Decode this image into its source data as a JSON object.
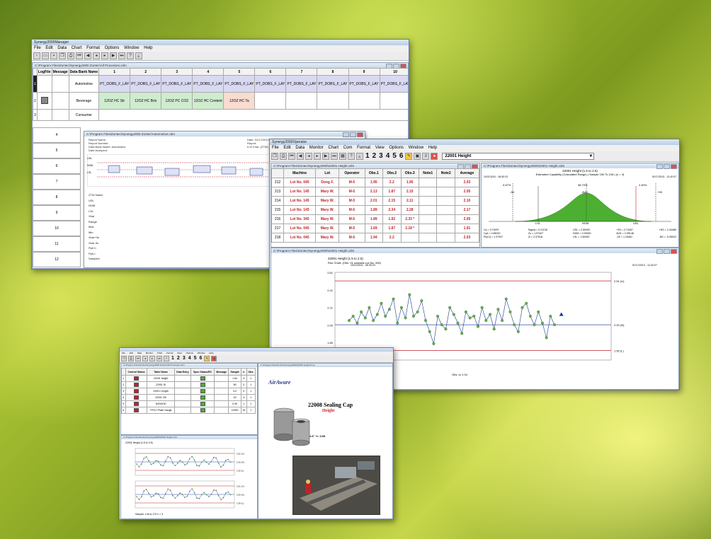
{
  "manager": {
    "title": "Synergy2000Manager",
    "menu": [
      "File",
      "Edit",
      "Data",
      "Chart",
      "Format",
      "Options",
      "Window",
      "Help"
    ],
    "doc_title": "C:\\Program Files\\Zontec\\Synergy2000 Zontec\\All Processes.cdm",
    "col_headers": [
      "LogFile",
      "Message",
      "Data Bank Name",
      "1",
      "2",
      "3",
      "4",
      "5",
      "6",
      "7",
      "8",
      "9",
      "10"
    ],
    "row_numbers": [
      "1",
      "2",
      "3",
      "4",
      "5",
      "6",
      "7",
      "8",
      "9",
      "10",
      "11",
      "12"
    ],
    "row1_name": "Automotive",
    "row2_name": "Beverage",
    "row3_name": "Consumer",
    "row1_cells": [
      "PT_DOBS_F_LAY",
      "PT_DOBS_F_LAY",
      "PT_DOBS_F_LAY",
      "PT_DOBS_F_LAY",
      "PT_DOBS_F_LAY",
      "PT_DOBS_F_LAY",
      "PT_DOBS_F_LAY",
      "PT_DOBS_F_LAY",
      "PT_DOBS_F_LAY",
      "PT_DOBS_F_LAY"
    ],
    "row2_cells": [
      "12OZ HC Str",
      "12OZ HC Brix",
      "12OZ PC CO2",
      "12OZ HC Content",
      "12OZ HC Ta"
    ],
    "inner_title": "C:\\Program Files\\Zontec\\Synergy2000 Zontec\\Automotive.cdm",
    "inner_info": [
      "Report Name:",
      "Report Number:",
      "Data Bank Name: Automotive",
      "Date Analyzed:"
    ],
    "inner_info_right": [
      "Date: 01/17/2013",
      "Report:",
      "# of Char. (ZTW) Rows: 10"
    ],
    "chart_labels": [
      "USL",
      "NOM",
      "LSL"
    ],
    "stat_rows": [
      "ZTW Name",
      "USL",
      "NOM",
      "LSL",
      "Xbar",
      "Range",
      "Max",
      "Min",
      "Xbar+3s",
      "Xbar-3s",
      "Ppk+/-",
      "Ppk-/-",
      "Samples"
    ]
  },
  "operator": {
    "title": "Synergy2000Operator",
    "menu": [
      "File",
      "Edit",
      "Data",
      "Monitor",
      "Chart",
      "Com",
      "Format",
      "View",
      "Options",
      "Window",
      "Help"
    ],
    "toolbar_numbers": [
      "1",
      "2",
      "3",
      "4",
      "5",
      "6"
    ],
    "combo_value": "22001 Height",
    "table_title": "C:\\Program Files\\Zontec\\Synergy2000\\22001 Height.cdm",
    "table_headers": [
      "",
      "Machine",
      "Lot",
      "Operator",
      "Obs.1",
      "Obs.2",
      "Obs.3",
      "Note1",
      "Note2",
      "Average"
    ],
    "rows": [
      {
        "n": "212",
        "machine": "Lot No. 045",
        "lot": "Dong F.",
        "op": "M-5",
        "o1": "1.95",
        "o2": "2.2",
        "o3": "1.95",
        "avg": "2.03"
      },
      {
        "n": "213",
        "machine": "Lot No. 145",
        "lot": "Mary W.",
        "op": "M-5",
        "o1": "2.13",
        "o2": "1.87",
        "o3": "2.15",
        "avg": "2.05"
      },
      {
        "n": "214",
        "machine": "Lot No. 145",
        "lot": "Mary W.",
        "op": "M-5",
        "o1": "2.01",
        "o2": "2.15",
        "o3": "2.11",
        "avg": "2.10"
      },
      {
        "n": "215",
        "machine": "Lot No. 145",
        "lot": "Mary W.",
        "op": "M-5",
        "o1": "1.89",
        "o2": "2.34",
        "o3": "2.28",
        "avg": "2.17"
      },
      {
        "n": "216",
        "machine": "Lot No. 345",
        "lot": "Mary W.",
        "op": "M-5",
        "o1": "1.89",
        "o2": "1.92",
        "o3": "2.33 *",
        "avg": "2.05"
      },
      {
        "n": "217",
        "machine": "Lot No. 045",
        "lot": "Mary W.",
        "op": "M-5",
        "o1": "1.69",
        "o2": "1.87",
        "o3": "2.18 *",
        "avg": "1.91"
      },
      {
        "n": "218",
        "machine": "Lot No. 045",
        "lot": "Mary W.",
        "op": "M-5",
        "o1": "1.94",
        "o2": "2.2",
        "o3": "",
        "avg": "2.03"
      }
    ],
    "capability_title": "C:\\Program Files\\Zontec\\Synergy2000\\22001 Height.cdm",
    "capability_heading": "22001 Height (1.5 to 2.5)",
    "capability_sub": "Estimated Capability (Calculated Range) | Sample 150 To 218 | (n = 3)",
    "capability_left_date": "10/21/2011 - 06:30:23",
    "capability_right_date": "01/17/2013 - 12:42:07",
    "capability_pcts": [
      "0.87%",
      "98.70%",
      "2.40%"
    ],
    "capability_marks": [
      "-3S",
      "AVG",
      "+3S",
      "LSL",
      "NOM",
      "USL"
    ],
    "capability_stats": [
      [
        "Cp = 0.79497",
        "Sigma = 0.21216",
        "USL = 2.50000",
        "+3S = 2.74407",
        "+NS = 2.44485"
      ],
      [
        "Cpk = 0.85022",
        "Zu = 1.97407",
        "NOM = 2.00000",
        "AVG = 2.05148",
        "",
        ""
      ],
      [
        "Pk(Cl) = 1.37937",
        "Zl = 2.37518",
        "LSL = 1.50000",
        "-3S = 1.15461",
        "-NS = -0.95022"
      ]
    ],
    "run_title": "C:\\Program Files\\Zontec\\Synergy2000\\22001 Height.cdm",
    "run_heading": "22001 Height (1.5 to 2.5)",
    "run_sub": "Run Chart: (Obs. 01 contains Lot No. 345)",
    "run_left_date": "10/21/2011 - 06:30:23",
    "run_right_date": "01/17/2013 - 12:42:07",
    "run_yticks": [
      "2.61",
      "2.41",
      "2.21",
      "2.00",
      "1.80",
      "1.59"
    ],
    "run_limits": [
      "2.51 (U)",
      "2.00 (N)",
      "1.50 (L)"
    ],
    "run_footer": "Obs. to 1.34"
  },
  "third": {
    "table_title": "C:\\Program Files\\Zontec\\Synergy2000 Zontec\\All Processes.cdm",
    "headers": [
      "",
      "Control Status",
      "Table Name",
      "Data Entry",
      "Spec Status/RC",
      "Message",
      "Sample",
      "n",
      "Obs."
    ],
    "rows": [
      {
        "n": "1",
        "name": "22001 height",
        "sample": "1.64",
        "nn": "3",
        "obs": "1"
      },
      {
        "n": "2",
        "name": "22001 ID",
        "sample": "80",
        "nn": "3",
        "obs": "1"
      },
      {
        "n": "3",
        "name": "22001 Length",
        "sample": "4.0",
        "nn": "3",
        "obs": "1"
      },
      {
        "n": "4",
        "name": "22001 OD",
        "sample": "40",
        "nn": "3",
        "obs": "1"
      },
      {
        "n": "5",
        "name": "M200130",
        "sample": "0.05",
        "nn": "1",
        "obs": "1"
      },
      {
        "n": "6",
        "name": "TP317 Plate Gauge",
        "sample": "10000",
        "nn": "15",
        "obs": "1"
      }
    ],
    "image_title": "C:\\Program Files\\Zontec\\Synergy2000\\22001 Height.bmp",
    "logo": "AirAware",
    "part_title": "22008 Sealing Cap",
    "part_subtitle": "Height",
    "part_dim": "1.6\" +/- 0.05",
    "chart_title": "C:\\Program Files\\Zontec\\Synergy2000\\22001 Height.cdm",
    "chart_heading": "22001 Height (1.5 to 2.5)",
    "chart_limits_top": [
      "2.51 (U)",
      "2.00 (N)",
      "1.50 (L)"
    ],
    "chart_footer": "Sample: 146 to 170  n = 3"
  },
  "colors": {
    "accent_red": "#c0222a",
    "title_bar": "#c8d9ea",
    "green_dist": "#4caf32"
  }
}
